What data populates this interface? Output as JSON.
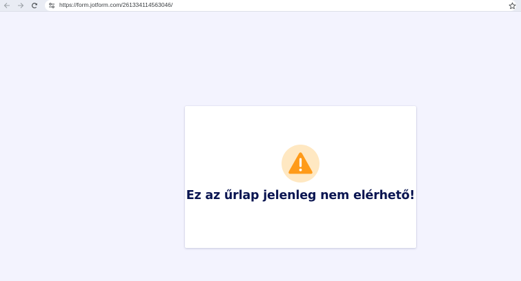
{
  "browser": {
    "url": "https://form.jotform.com/261334114563046/",
    "icons": {
      "back": "arrow-left-icon",
      "forward": "arrow-right-icon",
      "reload": "reload-icon",
      "site_info": "site-settings-icon",
      "bookmark": "star-icon"
    }
  },
  "page": {
    "background_color": "#f3f3fe",
    "message": {
      "icon": "warning-icon",
      "icon_color": "#ff9b19",
      "icon_bg_color": "#ffe8c2",
      "title": "Ez az űrlap jelenleg nem elérhető!",
      "title_color": "#0a1551"
    }
  }
}
